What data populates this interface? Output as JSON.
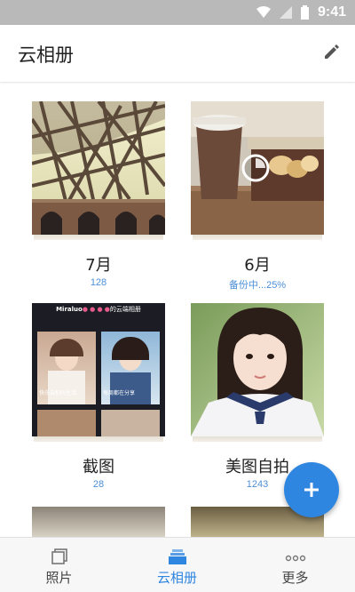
{
  "status_bar": {
    "time": "9:41"
  },
  "app_bar": {
    "title": "云相册"
  },
  "albums": [
    {
      "name": "7月",
      "count": "128"
    },
    {
      "name": "6月",
      "count": "备份中...25%",
      "progress": 0.25
    },
    {
      "name": "截图",
      "count": "28",
      "thumb_text": {
        "header": "Miraluo",
        "header_suffix": "的云端相册",
        "caption_1": "快乐自拍的生活",
        "caption_2": "每周都在分享"
      }
    },
    {
      "name": "美图自拍",
      "count": "1243"
    }
  ],
  "bottom_nav": {
    "items": [
      {
        "label": "照片",
        "icon": "photo-icon"
      },
      {
        "label": "云相册",
        "icon": "cloud-album-icon",
        "active": true
      },
      {
        "label": "更多",
        "icon": "more-dots-icon"
      }
    ]
  },
  "colors": {
    "accent": "#2f86e0",
    "count_text": "#4b8fd6",
    "status_bar": "#b9b9b9"
  }
}
